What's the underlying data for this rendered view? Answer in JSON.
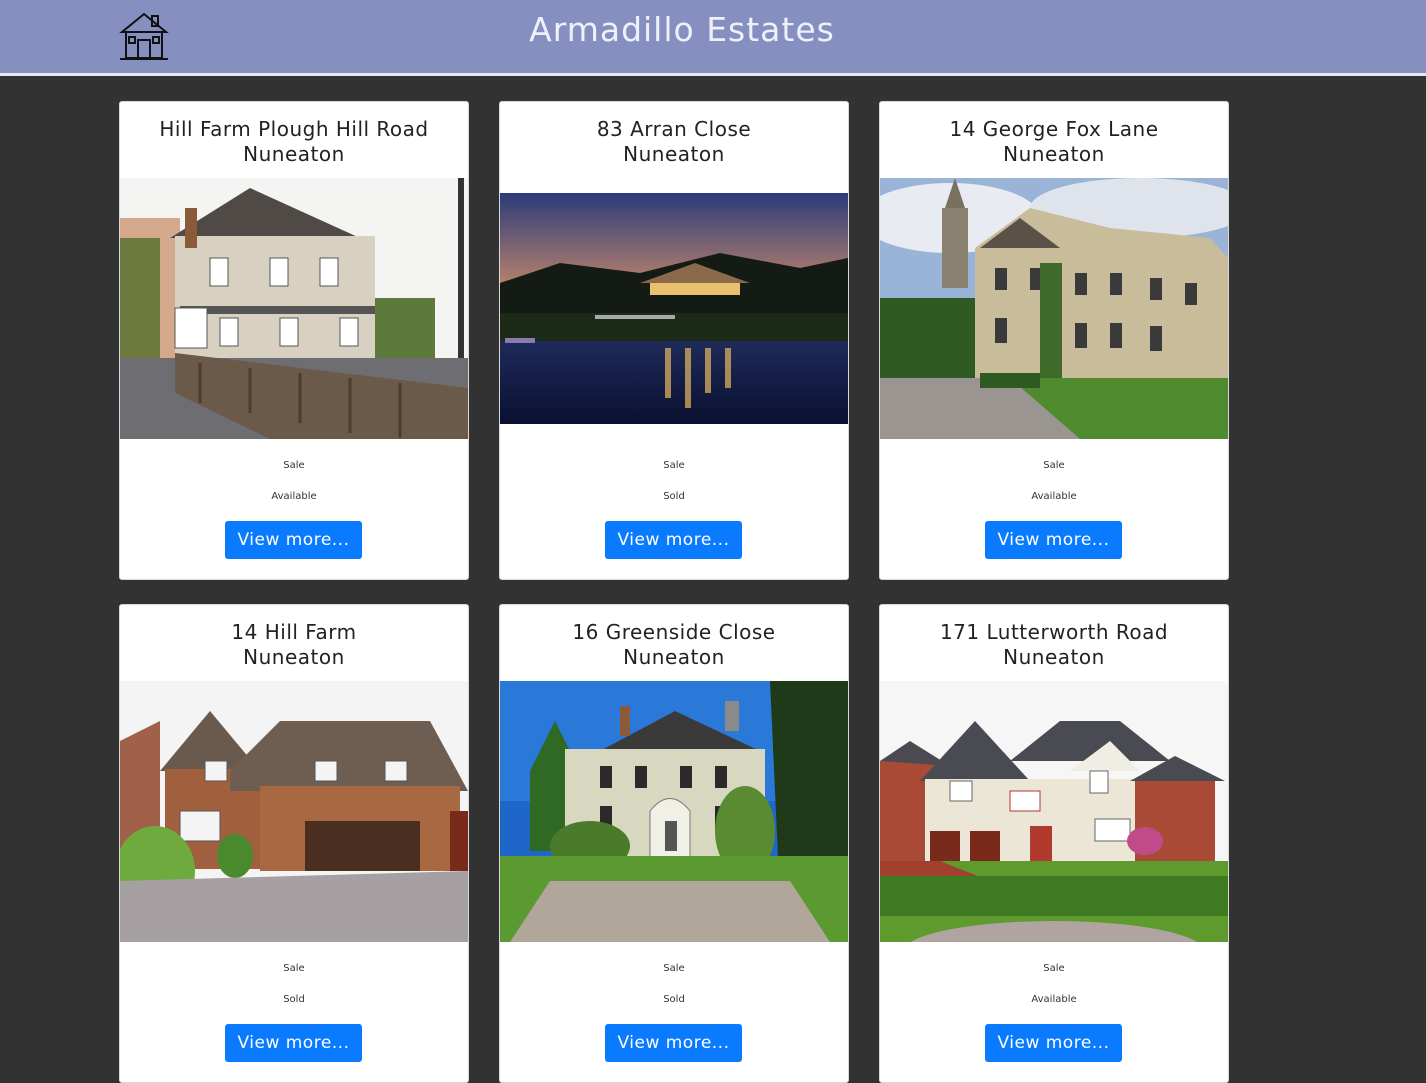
{
  "header": {
    "title": "Armadillo Estates",
    "logo_icon": "house-icon",
    "background": "#8690c0"
  },
  "listings": [
    {
      "address": "Hill Farm Plough Hill Road",
      "town": "Nuneaton",
      "type": "Sale",
      "status": "Available",
      "button": "View more..."
    },
    {
      "address": "83 Arran Close",
      "town": "Nuneaton",
      "type": "Sale",
      "status": "Sold",
      "button": "View more..."
    },
    {
      "address": "14 George Fox Lane",
      "town": "Nuneaton",
      "type": "Sale",
      "status": "Available",
      "button": "View more..."
    },
    {
      "address": "14 Hill Farm",
      "town": "Nuneaton",
      "type": "Sale",
      "status": "Sold",
      "button": "View more..."
    },
    {
      "address": "16 Greenside Close",
      "town": "Nuneaton",
      "type": "Sale",
      "status": "Sold",
      "button": "View more..."
    },
    {
      "address": "171 Lutterworth Road",
      "town": "Nuneaton",
      "type": "Sale",
      "status": "Available",
      "button": "View more..."
    }
  ],
  "colors": {
    "page_background": "#323232",
    "button": "#0a7bff",
    "card": "#ffffff"
  }
}
